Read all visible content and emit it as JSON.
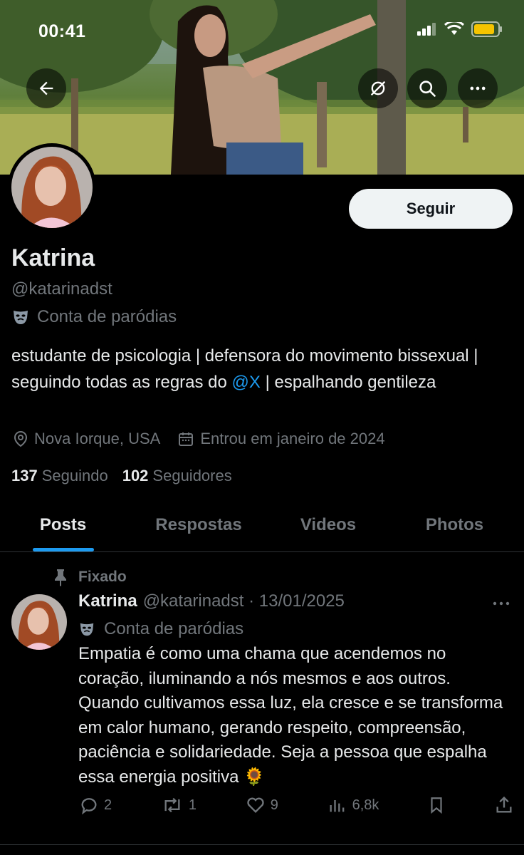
{
  "status_bar": {
    "time": "00:41",
    "icons": [
      "signal-icon",
      "wifi-icon",
      "battery-icon"
    ],
    "battery_color": "#f5c400"
  },
  "header": {
    "back_icon": "arrow-left-icon",
    "actions": [
      "grok-icon",
      "search-icon",
      "more-icon"
    ]
  },
  "profile": {
    "follow_label": "Seguir",
    "name": "Katrina",
    "handle": "@katarinadst",
    "parody_label": "Conta de paródias",
    "bio_part1": "estudante de psicologia | defensora do movimento bissexual | seguindo todas as regras do ",
    "bio_mention": "@X",
    "bio_part2": " | espalhando gentileza",
    "location": "Nova Iorque, USA",
    "joined": "Entrou em janeiro de 2024",
    "following_count": "137",
    "following_label": "Seguindo",
    "followers_count": "102",
    "followers_label": "Seguidores"
  },
  "tabs": [
    {
      "label": "Posts",
      "active": true
    },
    {
      "label": "Respostas",
      "active": false
    },
    {
      "label": "Videos",
      "active": false
    },
    {
      "label": "Photos",
      "active": false
    }
  ],
  "post": {
    "pinned_label": "Fixado",
    "author": "Katrina",
    "handle_date": "@katarinadst · 13/01/2025",
    "parody_label": "Conta de paródias",
    "text": "Empatia é como uma chama que acendemos no coração, iluminando a nós mesmos e aos outros. Quando cultivamos essa luz, ela cresce e se transforma em calor humano, gerando respeito, compreensão, paciência e solidariedade. Seja a pessoa que espalha essa energia positiva 🌻",
    "replies": "2",
    "reposts": "1",
    "likes": "9",
    "views": "6,8k"
  },
  "colors": {
    "accent": "#1d9bf0",
    "muted": "#71767b",
    "text": "#e7e9ea",
    "divider": "#2f3336"
  }
}
